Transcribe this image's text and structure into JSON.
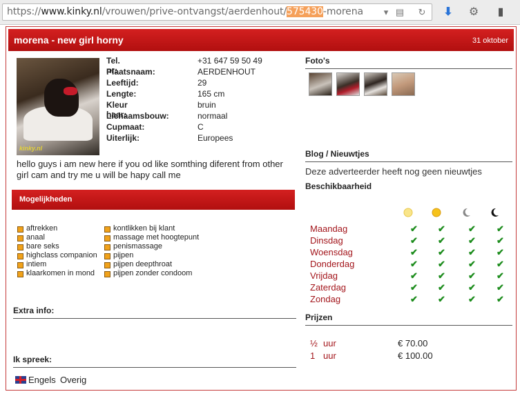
{
  "browser": {
    "url_scheme": "https://",
    "url_host": "www.kinky.nl",
    "url_path": "/vrouwen/prive-ontvangst/aerdenhout/",
    "url_highlight": "575430",
    "url_tail": "-morena"
  },
  "header": {
    "title": "morena - new girl horny",
    "date": "31 oktober"
  },
  "profile": {
    "photo_watermark": "kinky.nl",
    "fields": [
      {
        "label": "Tel. nr:",
        "value": "+31 647 59 50 49"
      },
      {
        "label": "Plaatsnaam:",
        "value": "AERDENHOUT"
      },
      {
        "label": "Leeftijd:",
        "value": "29"
      },
      {
        "label": "Lengte:",
        "value": "165 cm"
      },
      {
        "label": "Kleur haar:",
        "value": "bruin"
      },
      {
        "label": "Lichaamsbouw:",
        "value": "normaal"
      },
      {
        "label": "Cupmaat:",
        "value": "C"
      },
      {
        "label": "Uiterlijk:",
        "value": "Europees"
      }
    ],
    "description": "hello guys i am new here if you od like somthing diferent from other girl cam and try me u will be hapy call me"
  },
  "mogelijkheden": {
    "title": "Mogelijkheden",
    "col1": [
      "aftrekken",
      "anaal",
      "bare seks",
      "highclass companion",
      "intiem",
      "klaarkomen in mond"
    ],
    "col2": [
      "kontlikken bij klant",
      "massage met hoogtepunt",
      "penismassage",
      "pijpen",
      "pijpen deepthroat",
      "pijpen zonder condoom"
    ]
  },
  "extra_info": {
    "title": "Extra info:"
  },
  "languages": {
    "title": "Ik spreek:",
    "items": [
      "Engels",
      "Overig"
    ]
  },
  "fotos": {
    "title": "Foto's"
  },
  "blog": {
    "title": "Blog / Nieuwtjes",
    "text": "Deze adverteerder heeft nog geen nieuwtjes"
  },
  "beschikbaarheid": {
    "title": "Beschikbaarheid",
    "days": [
      "Maandag",
      "Dinsdag",
      "Woensdag",
      "Donderdag",
      "Vrijdag",
      "Zaterdag",
      "Zondag"
    ],
    "icons": [
      "sun-pale-icon",
      "sun-icon",
      "moon-crescent-icon",
      "moon-dark-icon"
    ],
    "check_glyph": "✔"
  },
  "prijzen": {
    "title": "Prijzen",
    "rows": [
      {
        "qty": "½",
        "unit": "uur",
        "price": "€ 70.00"
      },
      {
        "qty": "1",
        "unit": "uur",
        "price": "€ 100.00"
      }
    ]
  }
}
